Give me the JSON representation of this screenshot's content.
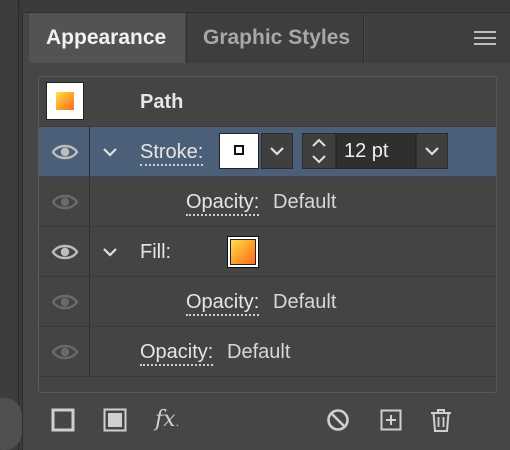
{
  "tabs": [
    {
      "label": "Appearance",
      "active": true
    },
    {
      "label": "Graphic Styles",
      "active": false
    }
  ],
  "panel_menu_icon": "hamburger-menu-icon",
  "appearance": {
    "object_label": "Path",
    "stroke": {
      "label": "Stroke:",
      "weight": "12 pt",
      "opacity_label": "Opacity:",
      "opacity_value": "Default"
    },
    "fill": {
      "label": "Fill:",
      "opacity_label": "Opacity:",
      "opacity_value": "Default"
    },
    "object_opacity": {
      "label": "Opacity:",
      "value": "Default"
    }
  },
  "toolbar": {
    "fx_label": "fx",
    "icons": [
      "add-new-stroke-icon",
      "add-new-fill-icon",
      "add-new-effect-icon",
      "clear-appearance-icon",
      "duplicate-item-icon",
      "delete-item-icon"
    ]
  },
  "colors": {
    "selection": "#4b5f78",
    "panel": "#464646",
    "gradient_start": "#ffe14a",
    "gradient_end": "#ff6a1e"
  }
}
